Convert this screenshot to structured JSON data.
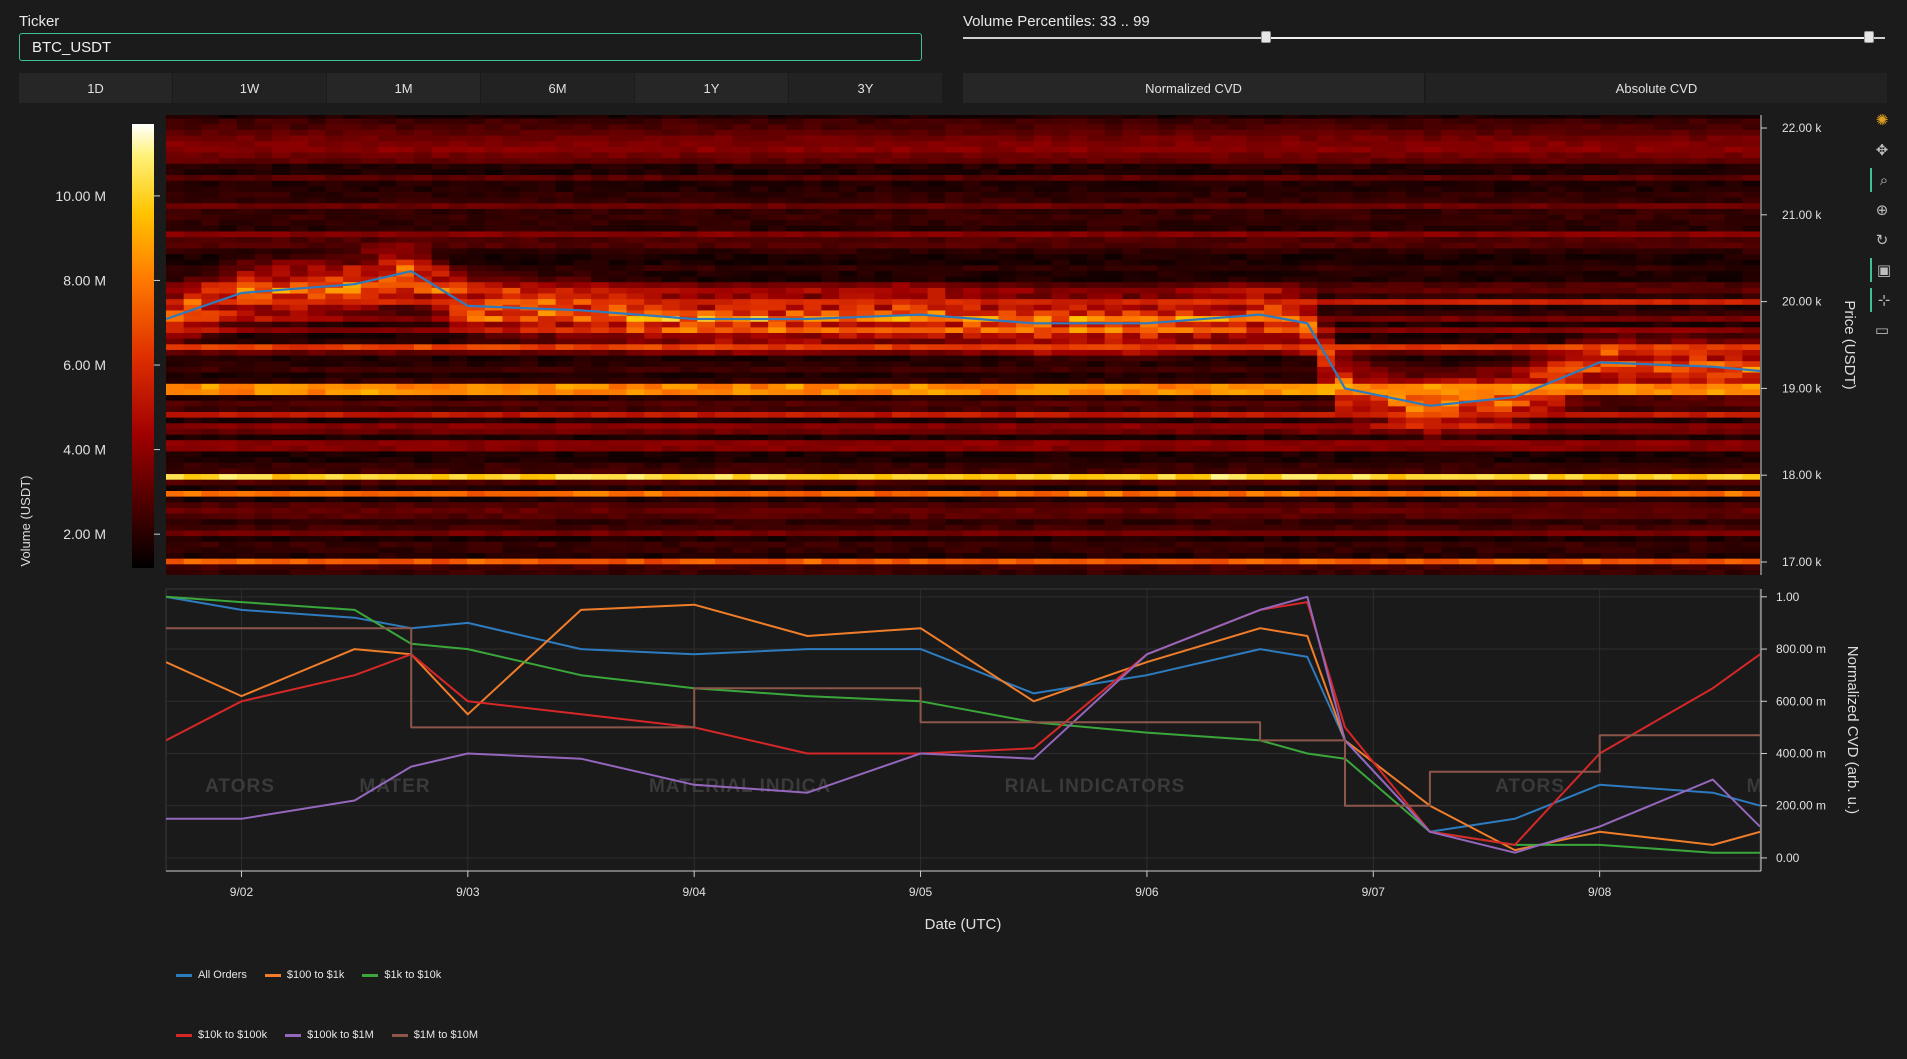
{
  "controls": {
    "ticker_label": "Ticker",
    "ticker_value": "BTC_USDT",
    "percentile_label": "Volume Percentiles: 33 .. 99",
    "percentile_low": 33,
    "percentile_high": 99,
    "timeframes": [
      "1D",
      "1W",
      "1M",
      "6M",
      "1Y",
      "3Y"
    ],
    "modes": [
      "Normalized CVD",
      "Absolute CVD"
    ]
  },
  "toolbar": [
    "logo-icon",
    "pan-icon",
    "box-zoom-icon",
    "wheel-zoom-icon",
    "reset-icon",
    "save-icon",
    "crosshair-icon",
    "hover-icon"
  ],
  "watermark": [
    "ATORS",
    "MATER",
    "MATERIAL INDICA",
    "RIAL INDICATORS",
    "ATORS",
    "M"
  ],
  "chart_data": [
    {
      "type": "heatmap",
      "ylabel": "Price (USDT)",
      "y_ticks": [
        "17.00 k",
        "18.00 k",
        "19.00 k",
        "20.00 k",
        "21.00 k",
        "22.00 k"
      ],
      "y_tick_values": [
        17000,
        18000,
        19000,
        20000,
        21000,
        22000
      ],
      "ylim": [
        16850,
        22150
      ],
      "xlim": [
        "2022-09-01 16:00",
        "2022-09-08 17:00"
      ],
      "colorbar": {
        "label": "Volume (USDT)",
        "ticks": [
          "2.00 M",
          "4.00 M",
          "6.00 M",
          "8.00 M",
          "10.00 M"
        ],
        "tick_values": [
          2000000,
          4000000,
          6000000,
          8000000,
          10000000
        ],
        "range": [
          1200000,
          11700000
        ],
        "colors": [
          "#000000",
          "#400000",
          "#a00000",
          "#e03000",
          "#ff7a00",
          "#ffc400",
          "#fff27a",
          "#ffffff"
        ]
      },
      "price_line": {
        "color": "#2e7bbf",
        "x": [
          "2022-09-01 16:00",
          "2022-09-02 00:00",
          "2022-09-02 12:00",
          "2022-09-02 18:00",
          "2022-09-03 00:00",
          "2022-09-03 12:00",
          "2022-09-04 00:00",
          "2022-09-04 12:00",
          "2022-09-05 00:00",
          "2022-09-05 12:00",
          "2022-09-06 00:00",
          "2022-09-06 12:00",
          "2022-09-06 17:00",
          "2022-09-06 21:00",
          "2022-09-07 06:00",
          "2022-09-07 15:00",
          "2022-09-08 00:00",
          "2022-09-08 12:00",
          "2022-09-08 17:00"
        ],
        "y": [
          19800,
          20100,
          20200,
          20350,
          19950,
          19900,
          19800,
          19800,
          19850,
          19750,
          19750,
          19850,
          19750,
          19000,
          18800,
          18900,
          19300,
          19250,
          19200
        ]
      },
      "levels": [
        {
          "price": 17000,
          "volume": 7800000
        },
        {
          "price": 17550,
          "volume": 3000000
        },
        {
          "price": 17780,
          "volume": 8200000
        },
        {
          "price": 18000,
          "volume": 10800000
        },
        {
          "price": 18500,
          "volume": 3500000
        },
        {
          "price": 18700,
          "volume": 5600000
        },
        {
          "price": 19000,
          "volume": 9000000
        },
        {
          "price": 19500,
          "volume": 7000000
        },
        {
          "price": 20000,
          "volume": 6000000
        }
      ]
    },
    {
      "type": "line",
      "xlabel": "Date (UTC)",
      "ylabel": "Normalized CVD (arb. u.)",
      "x_ticks": [
        "9/02",
        "9/03",
        "9/04",
        "9/05",
        "9/06",
        "9/07",
        "9/08"
      ],
      "y_ticks": [
        "0.00",
        "200.00 m",
        "400.00 m",
        "600.00 m",
        "800.00 m",
        "1.00"
      ],
      "y_tick_values": [
        0,
        0.2,
        0.4,
        0.6,
        0.8,
        1.0
      ],
      "ylim": [
        -0.05,
        1.03
      ],
      "xlim": [
        "2022-09-01 16:00",
        "2022-09-08 17:00"
      ],
      "grid": true,
      "legend_position": "bottom",
      "x": [
        "2022-09-01 16:00",
        "2022-09-02 00:00",
        "2022-09-02 12:00",
        "2022-09-02 18:00",
        "2022-09-03 00:00",
        "2022-09-03 12:00",
        "2022-09-04 00:00",
        "2022-09-04 12:00",
        "2022-09-05 00:00",
        "2022-09-05 12:00",
        "2022-09-06 00:00",
        "2022-09-06 12:00",
        "2022-09-06 17:00",
        "2022-09-06 21:00",
        "2022-09-07 06:00",
        "2022-09-07 15:00",
        "2022-09-08 00:00",
        "2022-09-08 12:00",
        "2022-09-08 17:00"
      ],
      "series": [
        {
          "name": "All Orders",
          "color": "#2e7bbf",
          "values": [
            1.0,
            0.95,
            0.92,
            0.88,
            0.9,
            0.8,
            0.78,
            0.8,
            0.8,
            0.63,
            0.7,
            0.8,
            0.77,
            0.45,
            0.1,
            0.15,
            0.28,
            0.25,
            0.2
          ]
        },
        {
          "name": "$100 to $1k",
          "color": "#f07d2a",
          "values": [
            0.75,
            0.62,
            0.8,
            0.78,
            0.55,
            0.95,
            0.97,
            0.85,
            0.88,
            0.6,
            0.75,
            0.88,
            0.85,
            0.45,
            0.2,
            0.03,
            0.1,
            0.05,
            0.1
          ]
        },
        {
          "name": "$1k to $10k",
          "color": "#3aa73a",
          "values": [
            1.0,
            0.98,
            0.95,
            0.82,
            0.8,
            0.7,
            0.65,
            0.62,
            0.6,
            0.52,
            0.48,
            0.45,
            0.4,
            0.38,
            0.1,
            0.05,
            0.05,
            0.02,
            0.02
          ]
        },
        {
          "name": "$10k to $100k",
          "color": "#d62728",
          "values": [
            0.45,
            0.6,
            0.7,
            0.78,
            0.6,
            0.55,
            0.5,
            0.4,
            0.4,
            0.42,
            0.78,
            0.95,
            0.98,
            0.5,
            0.1,
            0.05,
            0.4,
            0.65,
            0.78
          ]
        },
        {
          "name": "$100k to $1M",
          "color": "#9467bd",
          "values": [
            0.15,
            0.15,
            0.22,
            0.35,
            0.4,
            0.38,
            0.28,
            0.25,
            0.4,
            0.38,
            0.78,
            0.95,
            1.0,
            0.45,
            0.1,
            0.02,
            0.12,
            0.3,
            0.12
          ]
        },
        {
          "name": "$1M to $10M",
          "color": "#8c564b",
          "values": [
            0.88,
            0.88,
            0.88,
            0.5,
            0.5,
            0.5,
            0.65,
            0.65,
            0.52,
            0.52,
            0.52,
            0.45,
            0.45,
            0.2,
            0.33,
            0.33,
            0.47,
            0.47,
            0.47
          ]
        }
      ]
    }
  ]
}
